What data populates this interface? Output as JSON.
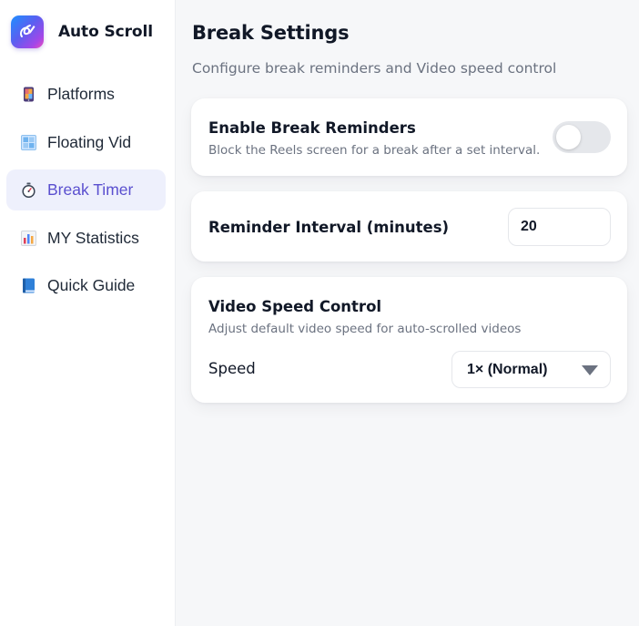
{
  "brand": {
    "name": "Auto Scroll",
    "logo_icon": "pen-swirl-icon"
  },
  "sidebar": {
    "items": [
      {
        "label": "Platforms",
        "icon": "phone-icon",
        "active": false
      },
      {
        "label": "Floating Vid",
        "icon": "window-grid-icon",
        "active": false
      },
      {
        "label": "Break Timer",
        "icon": "stopwatch-icon",
        "active": true
      },
      {
        "label": "MY Statistics",
        "icon": "bar-chart-icon",
        "active": false
      },
      {
        "label": "Quick Guide",
        "icon": "book-icon",
        "active": false
      }
    ]
  },
  "page": {
    "title": "Break Settings",
    "subtitle": "Configure break reminders and Video speed control"
  },
  "break_reminders": {
    "title": "Enable Break Reminders",
    "description": "Block the Reels screen for a break after a set interval.",
    "enabled": false
  },
  "interval": {
    "label": "Reminder Interval (minutes)",
    "value": "20"
  },
  "speed": {
    "title": "Video Speed Control",
    "description": "Adjust default video speed for auto-scrolled videos",
    "label": "Speed",
    "selected": "1× (Normal)"
  },
  "colors": {
    "accent": "#5a4fcf",
    "active_bg": "#eef0fc",
    "toggle_off": "#e5e7eb",
    "main_bg": "#f6f7f9"
  }
}
